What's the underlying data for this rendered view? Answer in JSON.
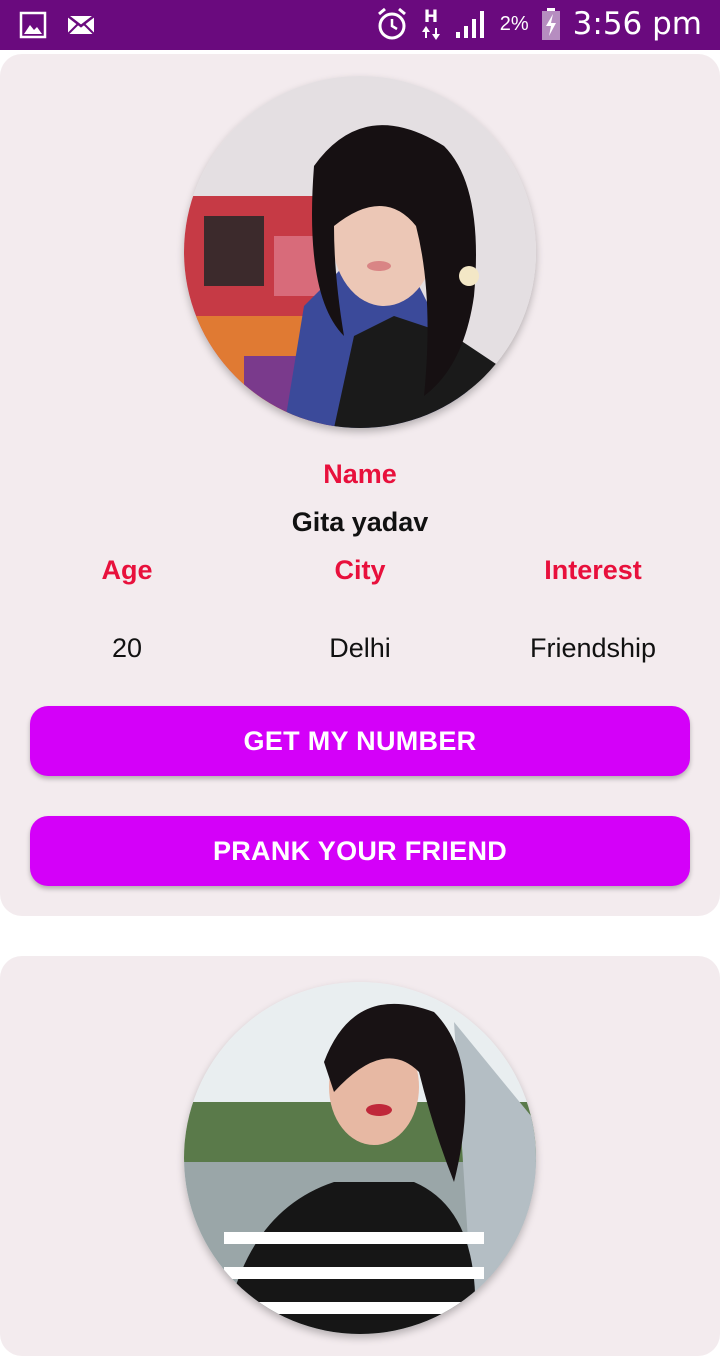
{
  "status_bar": {
    "time": "3:56 pm",
    "battery": "2%",
    "network": "H",
    "bg_color": "#6a0a7e",
    "icons_left": [
      "gallery-icon",
      "mail-icon"
    ],
    "icons_right": [
      "alarm-icon",
      "network-h-icon",
      "signal-icon",
      "battery-charging-icon"
    ]
  },
  "profiles": [
    {
      "name_label": "Name",
      "name": "Gita yadav",
      "age_label": "Age",
      "city_label": "City",
      "interest_label": "Interest",
      "age": "20",
      "city": "Delhi",
      "interest": "Friendship",
      "buttons": {
        "get_number": "GET MY NUMBER",
        "prank": "PRANK YOUR FRIEND"
      }
    }
  ],
  "colors": {
    "card_bg": "#f3ebee",
    "label_red": "#e8103c",
    "button_bg": "#d400f9"
  }
}
